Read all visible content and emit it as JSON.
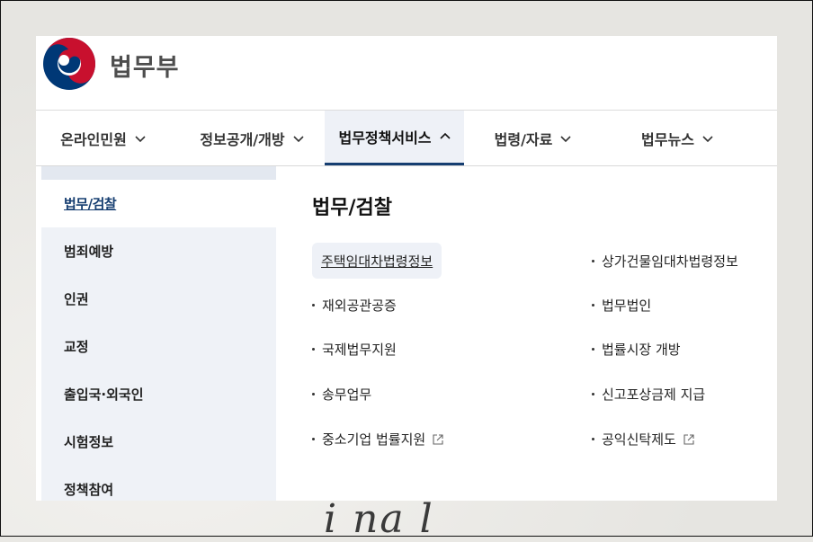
{
  "brand": {
    "name": "법무부"
  },
  "gnb": [
    {
      "label": "온라인민원",
      "active": false
    },
    {
      "label": "정보공개/개방",
      "active": false
    },
    {
      "label": "법무정책서비스",
      "active": true
    },
    {
      "label": "법령/자료",
      "active": false
    },
    {
      "label": "법무뉴스",
      "active": false
    }
  ],
  "sidebar": {
    "items": [
      {
        "label": "법무/검찰"
      },
      {
        "label": "범죄예방"
      },
      {
        "label": "인권"
      },
      {
        "label": "교정"
      },
      {
        "label": "출입국·외국인"
      },
      {
        "label": "시험정보"
      },
      {
        "label": "정책참여"
      }
    ]
  },
  "content": {
    "title": "법무/검찰",
    "links": [
      {
        "label": "주택임대차법령정보",
        "external": false
      },
      {
        "label": "상가건물임대차법령정보",
        "external": false
      },
      {
        "label": "재외공관공증",
        "external": false
      },
      {
        "label": "법무법인",
        "external": false
      },
      {
        "label": "국제법무지원",
        "external": false
      },
      {
        "label": "법률시장 개방",
        "external": false
      },
      {
        "label": "송무업무",
        "external": false
      },
      {
        "label": "신고포상금제 지급",
        "external": false
      },
      {
        "label": "중소기업 법률지원",
        "external": true
      },
      {
        "label": "공익신탁제도",
        "external": true
      }
    ]
  },
  "background": {
    "script_text": "i na l"
  },
  "colors": {
    "accent": "#163e71",
    "sidebar_bg": "#eff2f7",
    "logo_red": "#c8102e",
    "logo_blue": "#003876"
  }
}
